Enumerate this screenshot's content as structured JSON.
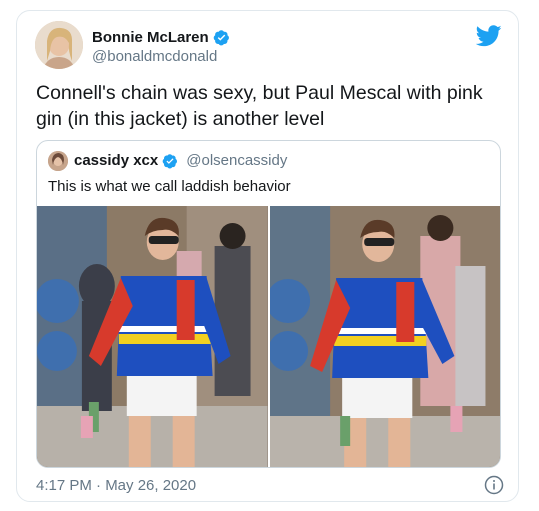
{
  "tweet": {
    "author_name": "Bonnie McLaren",
    "author_handle": "@bonaldmcdonald",
    "text": "Connell's chain was sexy, but Paul Mescal with pink gin (in this jacket) is another level",
    "timestamp": "4:17 PM · May 26, 2020"
  },
  "quoted_tweet": {
    "author_name": "cassidy xcx",
    "author_handle": "@olsencassidy",
    "text": "This is what we call laddish behavior"
  },
  "icons": {
    "verified": "verified-badge-icon",
    "brand": "twitter-bird-icon",
    "info": "info-icon"
  },
  "colors": {
    "brand_blue": "#1da1f2",
    "text_primary": "#14171a",
    "text_secondary": "#657786",
    "border": "#e1e8ed"
  }
}
